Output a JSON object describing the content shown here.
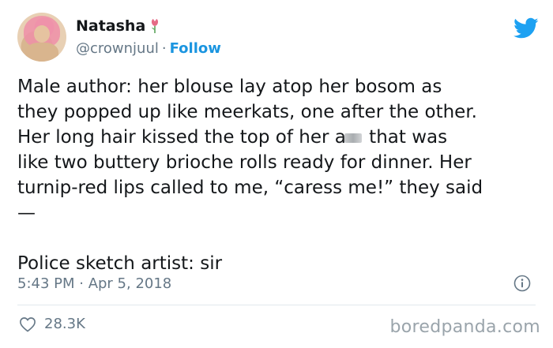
{
  "author": {
    "name": "Natasha",
    "handle": "@crownjuul",
    "separator": "·",
    "follow_label": "Follow",
    "avatar_icon": "profile-photo",
    "badge_icon": "flower-icon"
  },
  "platform_icon": "twitter-bird-icon",
  "tweet": {
    "line1": "Male author: her blouse lay atop her bosom as",
    "line2": "they popped up like meerkats, one after the other.",
    "line3_before_blur": "Her long hair kissed the top of her a",
    "line3_after_blur": " that was",
    "line4": "like two buttery brioche rolls ready for dinner. Her",
    "line5": "turnip-red lips called to me, “caress me!” they said",
    "line6": "—",
    "line7": "Police sketch artist: sir"
  },
  "timestamp": "5:43 PM · Apr 5, 2018",
  "likes": "28.3K",
  "watermark": "boredpanda.com",
  "colors": {
    "accent": "#1b95e0",
    "secondary_text": "#657786",
    "primary_text": "#14171a"
  }
}
